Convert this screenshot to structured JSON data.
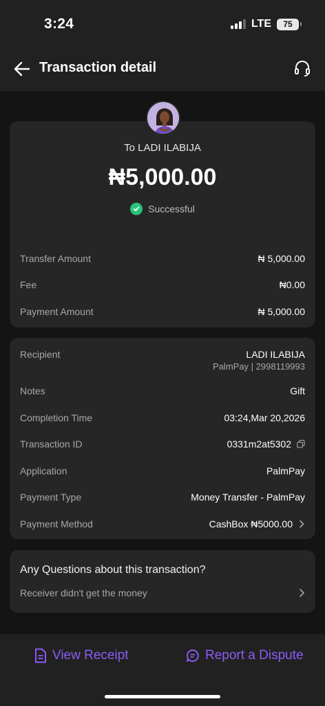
{
  "status_bar": {
    "time": "3:24",
    "network": "LTE",
    "battery": "75"
  },
  "header": {
    "title": "Transaction detail",
    "back_icon": "arrow-left-icon",
    "support_icon": "headset-icon"
  },
  "summary": {
    "to_label": "To LADI ILABIJA",
    "amount": "₦5,000.00",
    "status": "Successful",
    "rows": [
      {
        "label": "Transfer Amount",
        "value": "₦ 5,000.00"
      },
      {
        "label": "Fee",
        "value": "₦0.00"
      },
      {
        "label": "Payment Amount",
        "value": "₦ 5,000.00"
      }
    ]
  },
  "details": {
    "recipient_label": "Recipient",
    "recipient_name": "LADI ILABIJA",
    "recipient_account": "PalmPay | 2998119993",
    "notes_label": "Notes",
    "notes_value": "Gift",
    "completion_label": "Completion Time",
    "completion_value": "03:24,Mar 20,2026",
    "txn_label": "Transaction ID",
    "txn_value": "0331m2at5302",
    "application_label": "Application",
    "application_value": "PalmPay",
    "payment_type_label": "Payment Type",
    "payment_type_value": "Money Transfer - PalmPay",
    "payment_method_label": "Payment Method",
    "payment_method_value": "CashBox ₦5000.00"
  },
  "questions": {
    "title": "Any Questions about this transaction?",
    "item": "Receiver didn't get the money"
  },
  "actions": {
    "view_receipt": "View Receipt",
    "report_dispute": "Report a Dispute"
  },
  "colors": {
    "accent": "#8b5cf6",
    "success": "#27c47a",
    "card": "#262626",
    "background": "#141414"
  }
}
